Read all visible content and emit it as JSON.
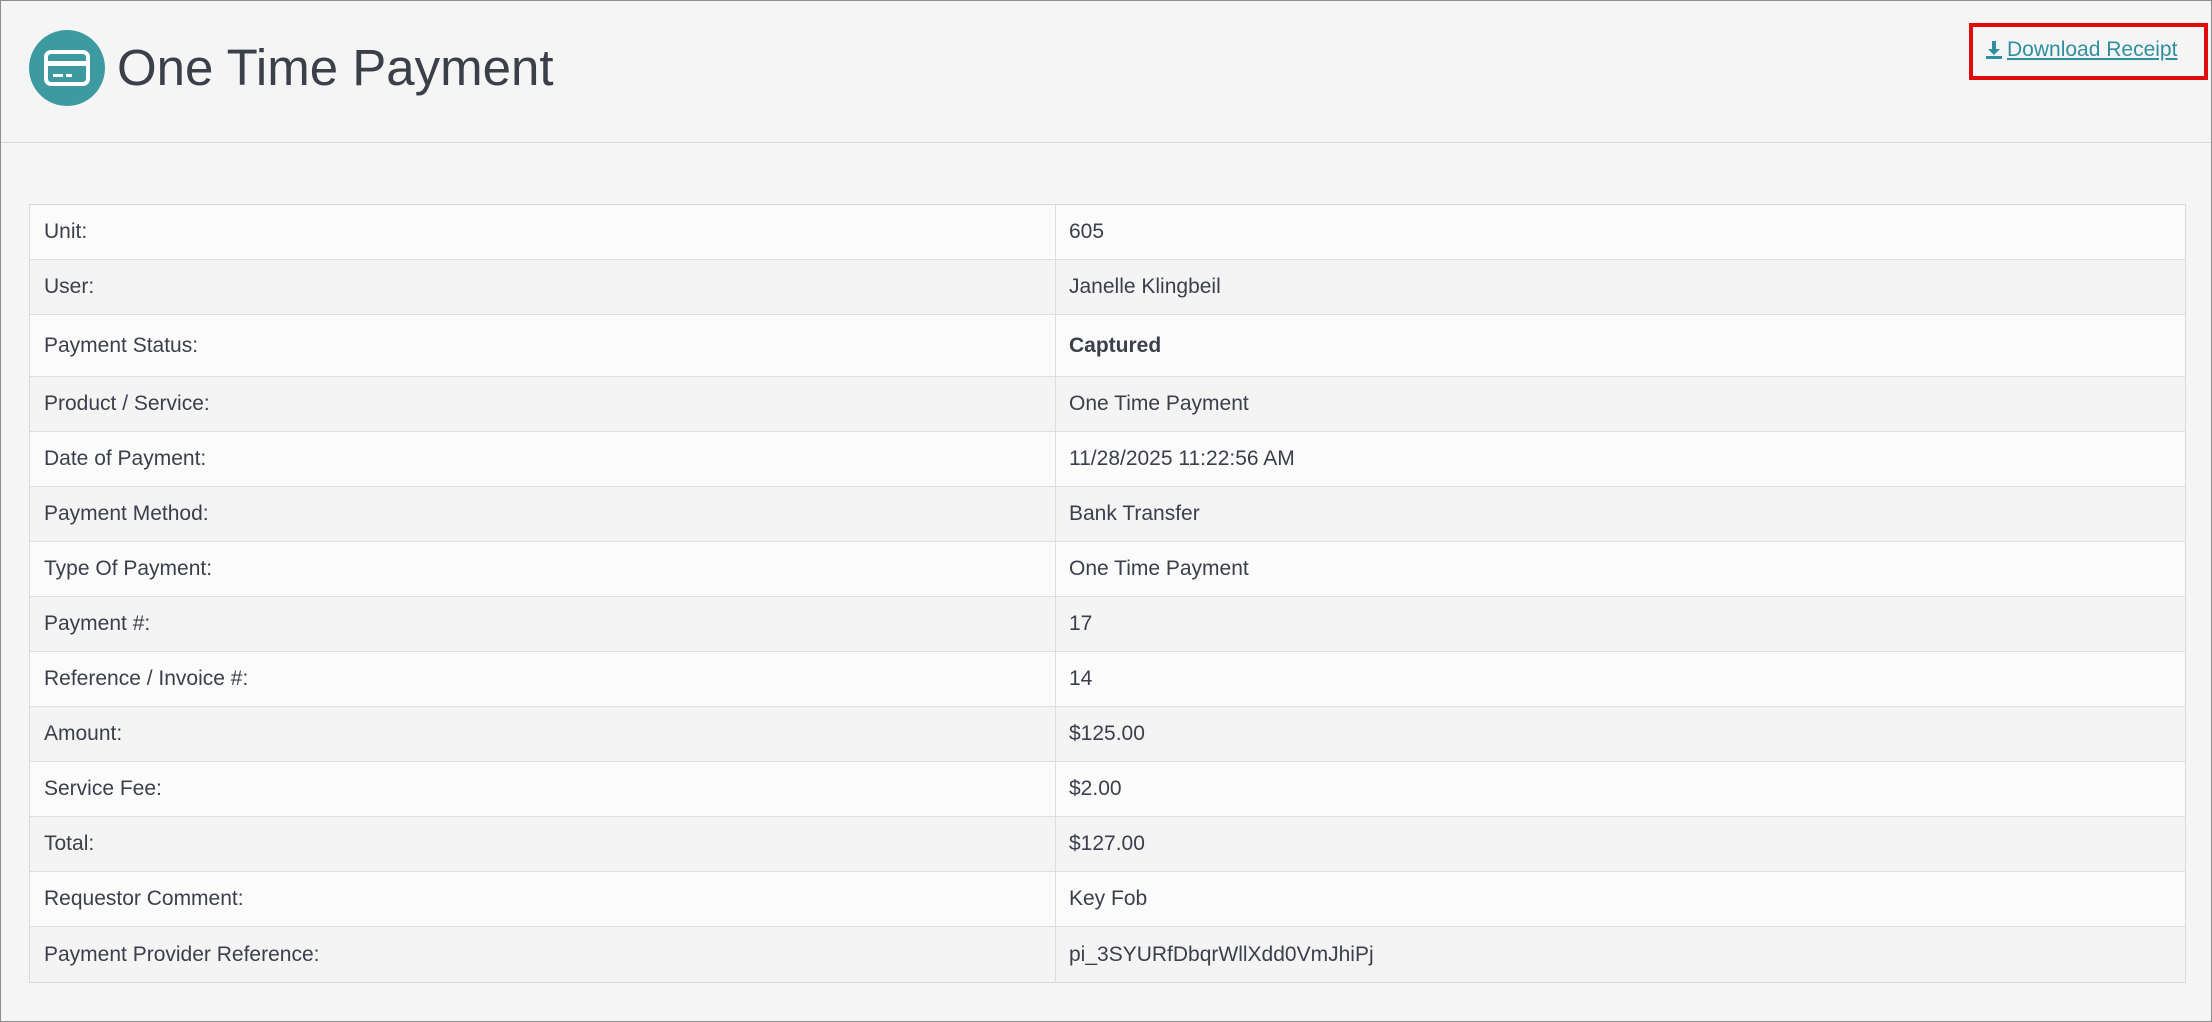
{
  "header": {
    "title": "One Time Payment",
    "download_label": "Download Receipt"
  },
  "payment_details": [
    {
      "label": "Unit:",
      "value": "605"
    },
    {
      "label": "User:",
      "value": "Janelle Klingbeil"
    },
    {
      "label": "Payment Status:",
      "value": "Captured"
    },
    {
      "label": "Product / Service:",
      "value": "One Time Payment"
    },
    {
      "label": "Date of Payment:",
      "value": "11/28/2025 11:22:56 AM"
    },
    {
      "label": "Payment Method:",
      "value": "Bank Transfer"
    },
    {
      "label": "Type Of Payment:",
      "value": "One Time Payment"
    },
    {
      "label": "Payment #:",
      "value": "17"
    },
    {
      "label": "Reference / Invoice #:",
      "value": "14"
    },
    {
      "label": "Amount:",
      "value": "$125.00"
    },
    {
      "label": "Service Fee:",
      "value": "$2.00"
    },
    {
      "label": "Total:",
      "value": "$127.00"
    },
    {
      "label": "Requestor Comment:",
      "value": "Key Fob"
    },
    {
      "label": "Payment Provider Reference:",
      "value": "pi_3SYURfDbqrWllXdd0VmJhiPj"
    }
  ],
  "colors": {
    "accent": "#3d9aa0",
    "link": "#2f8f9f",
    "highlight_border": "#e00b0b",
    "text": "#3b3f4a"
  },
  "icons": {
    "title": "credit-card-icon",
    "download": "download-icon"
  }
}
